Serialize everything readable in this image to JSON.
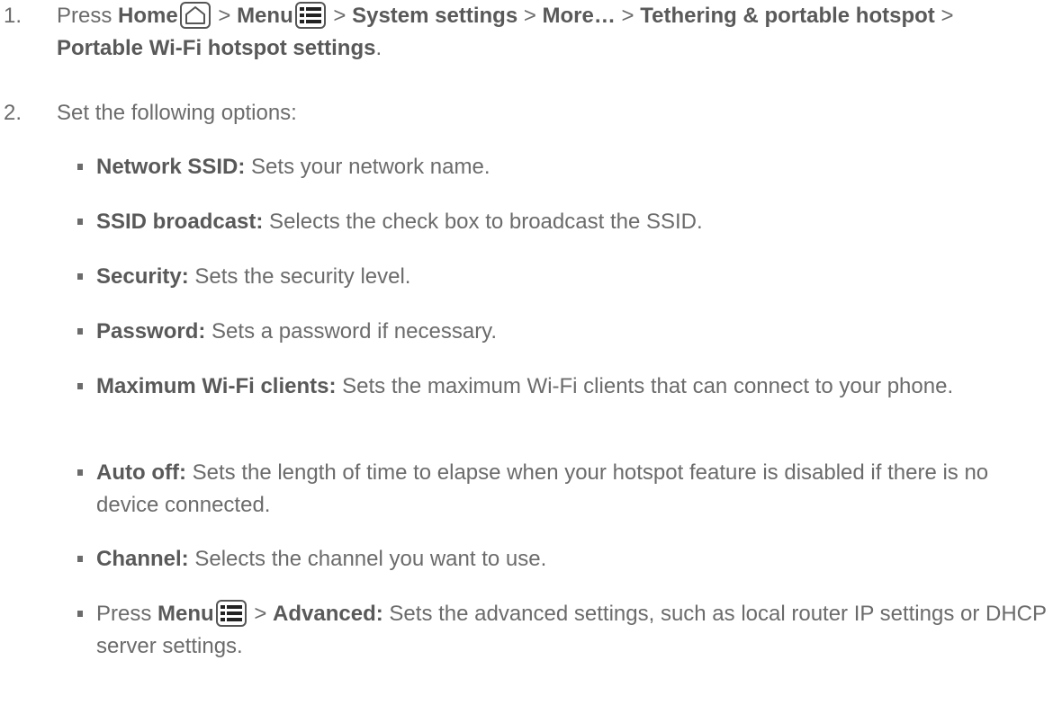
{
  "step1": {
    "number": "1.",
    "press": "Press ",
    "home": "Home",
    "gt1": " > ",
    "menu": "Menu",
    "gt2": " > ",
    "system_settings": "System settings",
    "gt3": " > ",
    "more": "More…",
    "gt4": " > ",
    "tethering": "Tethering & portable hotspot",
    "gt5": " > ",
    "portable": "Portable Wi-Fi hotspot settings",
    "period": "."
  },
  "step2": {
    "number": "2.",
    "text": "Set the following options:"
  },
  "options": [
    {
      "term": "Network SSID:",
      "desc": " Sets your network name."
    },
    {
      "term": "SSID broadcast:",
      "desc": " Selects the check box to broadcast the SSID."
    },
    {
      "term": "Security:",
      "desc": " Sets the security level."
    },
    {
      "term": "Password:",
      "desc": " Sets a password if necessary."
    },
    {
      "term": "Maximum Wi-Fi clients:",
      "desc": " Sets the maximum Wi-Fi clients that can connect to your phone."
    },
    {
      "term": "Auto off:",
      "desc": " Sets the length of time to elapse when your hotspot feature is disabled if there is no device connected."
    },
    {
      "term": "Channel:",
      "desc": " Selects the channel you want to use."
    }
  ],
  "last_option": {
    "press": "Press ",
    "menu": "Menu",
    "gt": " > ",
    "term": "Advanced:",
    "desc": " Sets the advanced settings, such as local router IP settings or DHCP server settings."
  },
  "icons": {
    "home": "home-icon",
    "menu": "menu-icon"
  }
}
